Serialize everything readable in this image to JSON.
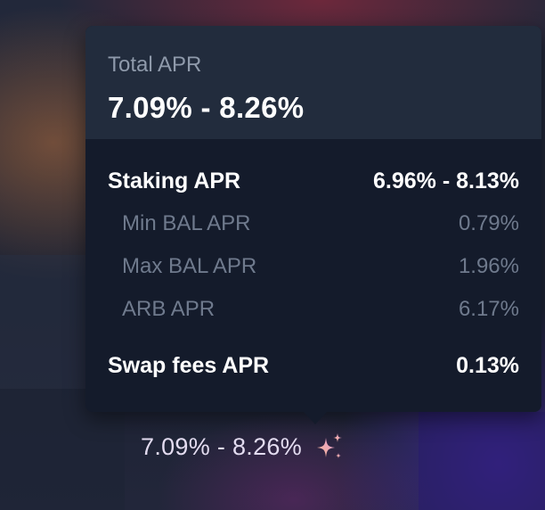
{
  "tooltip": {
    "header_label": "Total APR",
    "header_value": "7.09% - 8.26%",
    "staking": {
      "label": "Staking APR",
      "value": "6.96% - 8.13%"
    },
    "breakdown": [
      {
        "label": "Min BAL APR",
        "value": "0.79%"
      },
      {
        "label": "Max BAL APR",
        "value": "1.96%"
      },
      {
        "label": "ARB APR",
        "value": "6.17%"
      }
    ],
    "swap_fees": {
      "label": "Swap fees APR",
      "value": "0.13%"
    }
  },
  "trigger": {
    "apr_text": "7.09% - 8.26%",
    "icon": "sparkles-icon"
  },
  "colors": {
    "tooltip_bg": "#141b2b",
    "header_bg": "#222c3d",
    "primary_text": "#ffffff",
    "muted_text": "#6f7a8d",
    "sparkle_gradient": [
      "#f5b58a",
      "#e8a0d8"
    ]
  }
}
